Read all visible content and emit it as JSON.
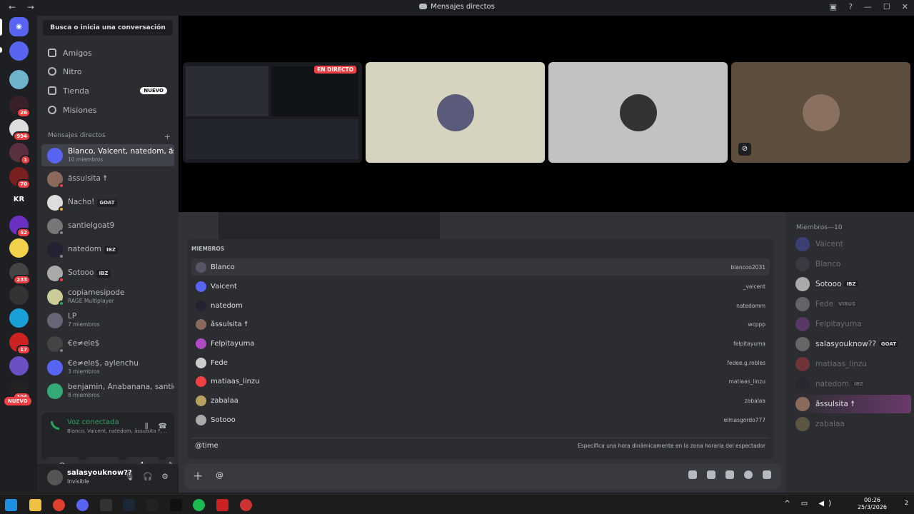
{
  "window": {
    "title": "Mensajes directos",
    "nav": "← →"
  },
  "rail": {
    "badges": [
      "26",
      "994",
      "1",
      "70",
      "52",
      "233",
      "17",
      "104"
    ],
    "text_server": "KR",
    "nuevo": "NUEVO"
  },
  "sidebar": {
    "search": "Busca o inicia una conversación",
    "nav": [
      {
        "label": "Amigos"
      },
      {
        "label": "Nitro"
      },
      {
        "label": "Tienda",
        "badge": "NUEVO"
      },
      {
        "label": "Misiones"
      }
    ],
    "dm_header": "Mensajes directos",
    "dm_add": "+",
    "dms": [
      {
        "name": "Blanco, Vaicent, natedom, ȁss...",
        "sub": "10 miembros"
      },
      {
        "name": "ȁssulsita ☨",
        "sub": ""
      },
      {
        "name": "Nacho!",
        "tag": "GOAT",
        "sub": ""
      },
      {
        "name": "santielgoat9",
        "sub": ""
      },
      {
        "name": "natedom",
        "tag": "IBZ",
        "sub": ""
      },
      {
        "name": "Sotooo",
        "tag": "IBZ",
        "sub": ""
      },
      {
        "name": "copiamesipode",
        "sub": "RAGE Multiplayer"
      },
      {
        "name": "LP",
        "sub": "7 miembros"
      },
      {
        "name": "€e≠ele$",
        "sub": ""
      },
      {
        "name": "€e≠ele$, aylenchu",
        "sub": "3 miembros"
      },
      {
        "name": "benjamin, Anabanana, santiel...",
        "sub": "8 miembros"
      }
    ],
    "voice": {
      "title": "Voz conectada",
      "members": "Blanco, Vaicent, natedom, ȁssulsita ☨, ..."
    },
    "user": {
      "name": "salasyouknow??",
      "status": "Invisible"
    }
  },
  "call": {
    "live_label": "EN DIRECTO"
  },
  "autocomplete": {
    "header": "MIEMBROS",
    "rows": [
      {
        "name": "Blanco",
        "username": "blancoo2031"
      },
      {
        "name": "Vaicent",
        "username": "_vaicent"
      },
      {
        "name": "natedom",
        "username": "natedomm"
      },
      {
        "name": "ȁssulsita ☨",
        "username": "wcppp"
      },
      {
        "name": "Felpitayuma",
        "username": "felpitayuma"
      },
      {
        "name": "Fede",
        "username": "fedee.g.robles"
      },
      {
        "name": "matiaas_linzu",
        "username": "matiaas_linzu"
      },
      {
        "name": "zabalaa",
        "username": "zabalaa"
      },
      {
        "name": "Sotooo",
        "username": "elmasgordo777"
      }
    ],
    "time": {
      "label": "@time",
      "desc": "Especifica una hora dinámicamente en la zona horaria del espectador"
    }
  },
  "composer": {
    "value": "@",
    "plus": "+"
  },
  "members_panel": {
    "header": "Miembros—10",
    "items": [
      {
        "name": "Vaicent",
        "dim": true
      },
      {
        "name": "Blanco",
        "dim": true
      },
      {
        "name": "Sotooo",
        "tag": "IBZ",
        "dim": false
      },
      {
        "name": "Fede",
        "tag": "VIRUS",
        "dim": true
      },
      {
        "name": "Felpitayuma",
        "dim": true
      },
      {
        "name": "salasyouknow??",
        "tag": "GOAT",
        "dim": false
      },
      {
        "name": "matiaas_linzu",
        "dim": true
      },
      {
        "name": "natedom",
        "tag": "IBZ",
        "dim": true
      },
      {
        "name": "ȁssulsita ☨",
        "dim": false
      },
      {
        "name": "zabalaa",
        "dim": true
      }
    ]
  },
  "taskbar": {
    "time": "00:26",
    "date": "25/3/2026",
    "notif": "2"
  }
}
